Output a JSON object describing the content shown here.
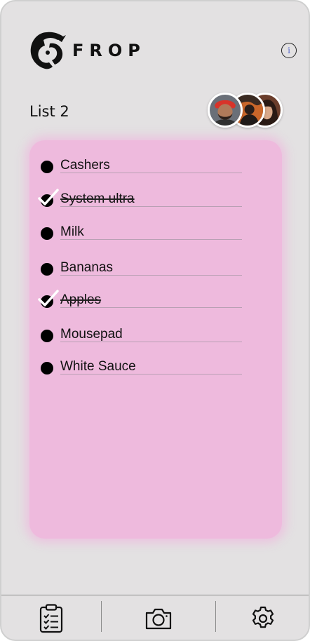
{
  "app": {
    "brand": "FROP",
    "info_icon": "i"
  },
  "list": {
    "title": "List 2",
    "items": [
      {
        "label": "Cashers",
        "checked": false
      },
      {
        "label": "System ultra",
        "checked": true
      },
      {
        "label": "Milk",
        "checked": false
      },
      {
        "label": "Bananas",
        "checked": false
      },
      {
        "label": "Apples",
        "checked": true
      },
      {
        "label": "Mousepad",
        "checked": false
      },
      {
        "label": "White Sauce",
        "checked": false
      }
    ]
  },
  "members": [
    "avatar-1",
    "avatar-2",
    "avatar-3"
  ],
  "tabbar": {
    "tabs": [
      {
        "icon": "clipboard-checklist-icon"
      },
      {
        "icon": "camera-icon"
      },
      {
        "icon": "gear-icon"
      }
    ]
  },
  "colors": {
    "background": "#e3e1e2",
    "card": "#eebadd",
    "text": "#111111"
  }
}
